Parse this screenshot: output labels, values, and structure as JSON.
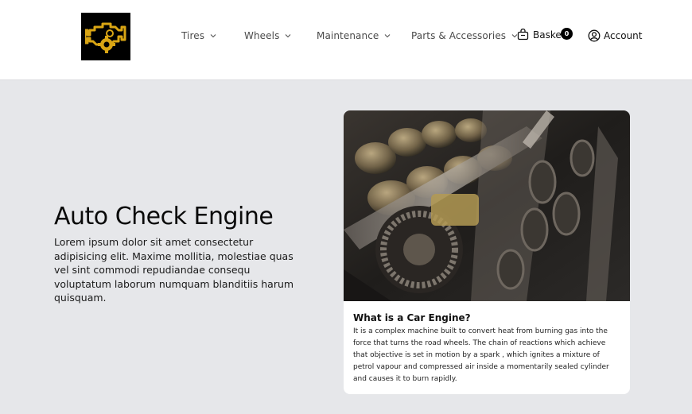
{
  "nav": {
    "items": [
      {
        "label": "Tires"
      },
      {
        "label": "Wheels"
      },
      {
        "label": "Maintenance"
      },
      {
        "label": "Parts & Accessories"
      }
    ],
    "basket": {
      "label": "Basket",
      "count": "0"
    },
    "account": {
      "label": "Account"
    }
  },
  "hero": {
    "title": "Auto Check Engine",
    "text": "Lorem ipsum dolor sit amet consectetur adipisicing elit. Maxime mollitia, molestiae quas vel sint commodi repudiandae consequ voluptatum laborum numquam blanditiis harum quisquam."
  },
  "card": {
    "title": "What is a Car Engine?",
    "text": "It is a complex machine built to convert heat from burning gas into the force that turns the road wheels. The chain of reactions which achieve that objective is set in motion by a spark , which ignites a mixture of petrol vapour and compressed air inside a momentarily sealed cylinder and causes it to burn rapidly."
  },
  "colors": {
    "header_bg": "#ffffff",
    "page_bg": "#e6e7ea",
    "logo_bg": "#000000",
    "logo_accent": "#d9a514"
  }
}
